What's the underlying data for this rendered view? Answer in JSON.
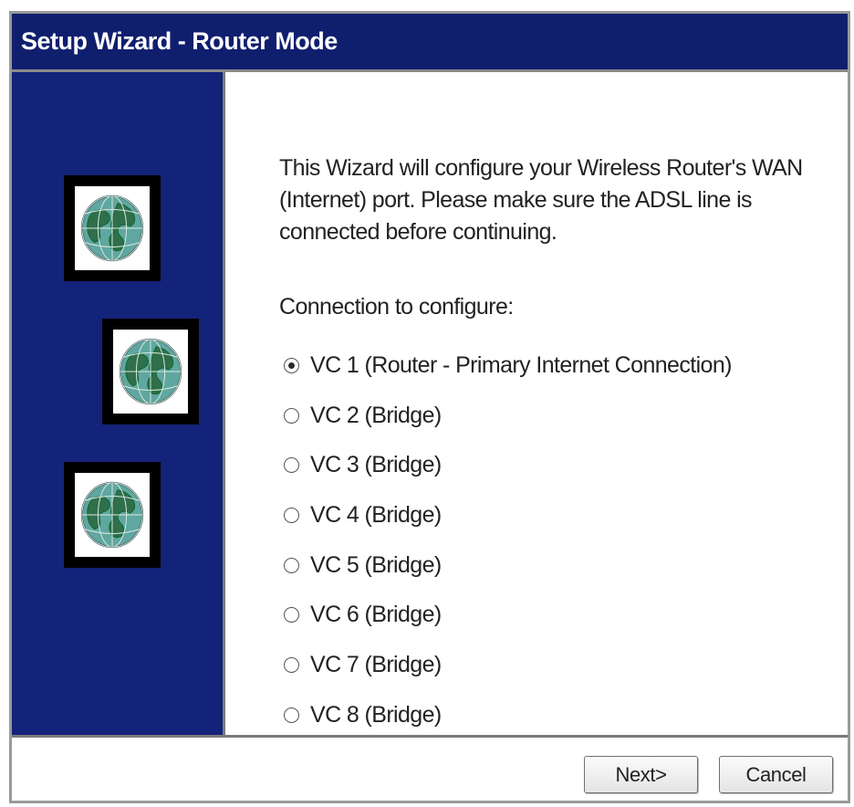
{
  "window": {
    "title": "Setup Wizard - Router Mode"
  },
  "sidebar": {
    "icons": [
      "globe-icon",
      "globe-icon",
      "globe-icon"
    ]
  },
  "content": {
    "intro_line1": "This Wizard will configure your Wireless Router's WAN",
    "intro_line2": "(Internet) port. Please make sure the ADSL line is",
    "intro_line3": "connected before continuing.",
    "connection_label": "Connection to configure:",
    "options": [
      {
        "label": "VC 1 (Router - Primary Internet Connection)",
        "selected": true
      },
      {
        "label": "VC 2 (Bridge)",
        "selected": false
      },
      {
        "label": "VC 3 (Bridge)",
        "selected": false
      },
      {
        "label": "VC 4 (Bridge)",
        "selected": false
      },
      {
        "label": "VC 5 (Bridge)",
        "selected": false
      },
      {
        "label": "VC 6 (Bridge)",
        "selected": false
      },
      {
        "label": "VC 7 (Bridge)",
        "selected": false
      },
      {
        "label": "VC 8 (Bridge)",
        "selected": false
      }
    ]
  },
  "footer": {
    "next_label": "Next>",
    "cancel_label": "Cancel"
  },
  "colors": {
    "title_bar": "#0f1f6e",
    "sidebar": "#13237a"
  }
}
